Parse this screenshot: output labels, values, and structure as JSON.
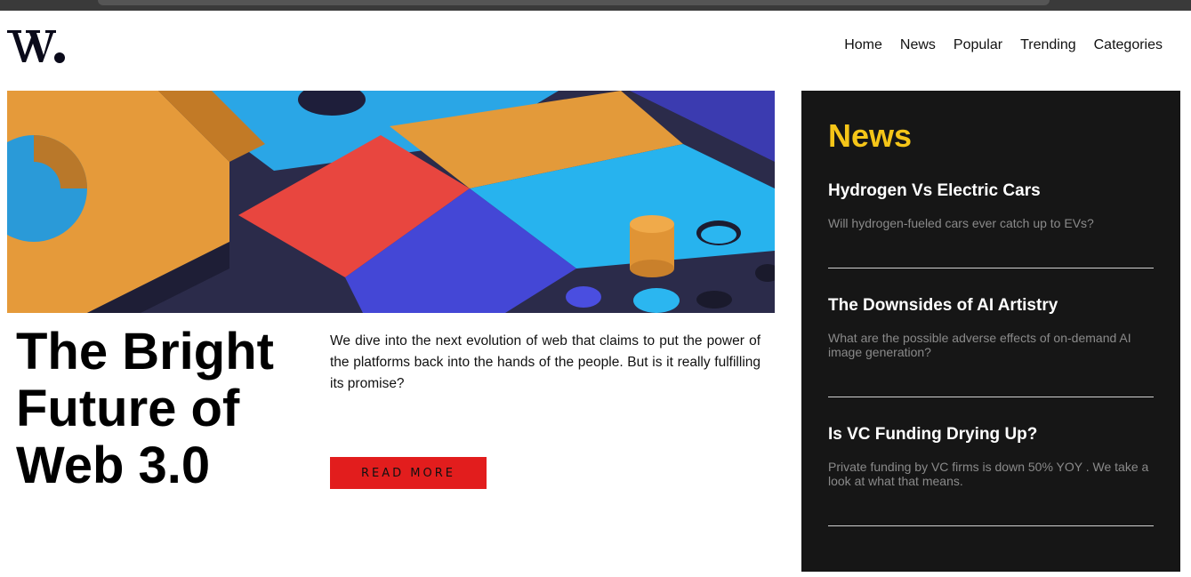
{
  "brand": {
    "logo_text": "W."
  },
  "nav": {
    "items": [
      "Home",
      "News",
      "Popular",
      "Trending",
      "Categories"
    ]
  },
  "hero": {
    "title": "The Bright Future of Web 3.0",
    "description": "We dive into the next evolution of web that claims to put the power of the platforms back into the hands of the people. But is it really fulfilling its promise?",
    "cta_label": "READ MORE"
  },
  "sidebar": {
    "heading": "News",
    "items": [
      {
        "title": "Hydrogen Vs Electric Cars",
        "summary": "Will hydrogen-fueled cars ever catch up to EVs?"
      },
      {
        "title": "The Downsides of AI Artistry",
        "summary": "What are the possible adverse effects of on-demand AI image generation?"
      },
      {
        "title": "Is VC Funding Drying Up?",
        "summary": "Private funding by VC firms is down 50% YOY . We take a look at what that means."
      }
    ]
  },
  "colors": {
    "accent_red": "#e21d1d",
    "accent_yellow": "#f5c518",
    "sidebar_bg": "#161616"
  }
}
